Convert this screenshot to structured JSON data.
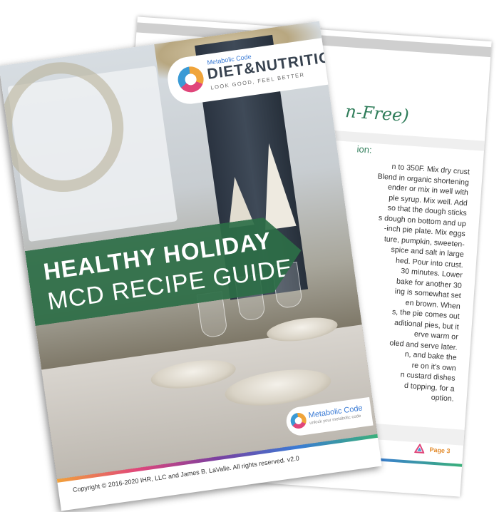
{
  "cover": {
    "logo_small": "Metabolic Code",
    "logo_big": "DIET&NUTRITION",
    "logo_tagline": "LOOK GOOD, FEEL BETTER",
    "title_line1": "HEALTHY HOLIDAY",
    "title_line2": "MCD RECIPE GUIDE",
    "bottom_logo_text": "Metabolic Code",
    "bottom_logo_sub": "unlock your metabolic code",
    "copyright": "Copyright © 2016-2020 IHR, LLC and James B. LaValle. All rights reserved. v2.0"
  },
  "back_page": {
    "title_fragment": "n-Free)",
    "subhead_fragment": "ion:",
    "lines": [
      "n to 350F.  Mix dry crust",
      "Blend in organic shortening",
      "ender or mix in well with",
      "ple syrup.  Mix well.  Add",
      "so that the dough sticks",
      "s dough on bottom and up",
      "-inch pie plate.  Mix eggs",
      "ture, pumpkin, sweeten-",
      "spice and salt in large",
      "hed.  Pour into crust.",
      "30 minutes.  Lower",
      "bake for another 30",
      "ing is somewhat set",
      "en brown.  When",
      "s, the pie comes out",
      "aditional pies, but it",
      "erve warm or",
      "oled and serve later.",
      "n, and bake the",
      "re on it's own",
      "n custard dishes",
      "d topping, for a",
      "option."
    ],
    "page_label": "Page 3"
  }
}
